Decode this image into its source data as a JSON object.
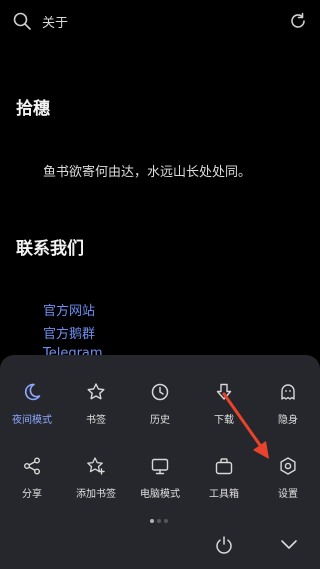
{
  "topbar": {
    "title": "关于"
  },
  "content": {
    "section1_title": "拾穗",
    "quote": "鱼书欲寄何由达，水远山长处处同。",
    "section2_title": "联系我们",
    "links": [
      "官方网站",
      "官方鹅群",
      "Telegram"
    ]
  },
  "menu": {
    "row1": [
      {
        "label": "夜间模式",
        "icon": "moon-icon",
        "active": true
      },
      {
        "label": "书签",
        "icon": "star-icon"
      },
      {
        "label": "历史",
        "icon": "clock-icon"
      },
      {
        "label": "下载",
        "icon": "download-icon"
      },
      {
        "label": "隐身",
        "icon": "ghost-icon"
      }
    ],
    "row2": [
      {
        "label": "分享",
        "icon": "share-icon"
      },
      {
        "label": "添加书签",
        "icon": "star-plus-icon"
      },
      {
        "label": "电脑模式",
        "icon": "monitor-icon"
      },
      {
        "label": "工具箱",
        "icon": "toolbox-icon"
      },
      {
        "label": "设置",
        "icon": "gear-icon"
      }
    ]
  },
  "colors": {
    "accent": "#8ea8ff",
    "link": "#6f8ff0",
    "sheet": "#26272c",
    "annotation_arrow": "#e8432c"
  }
}
